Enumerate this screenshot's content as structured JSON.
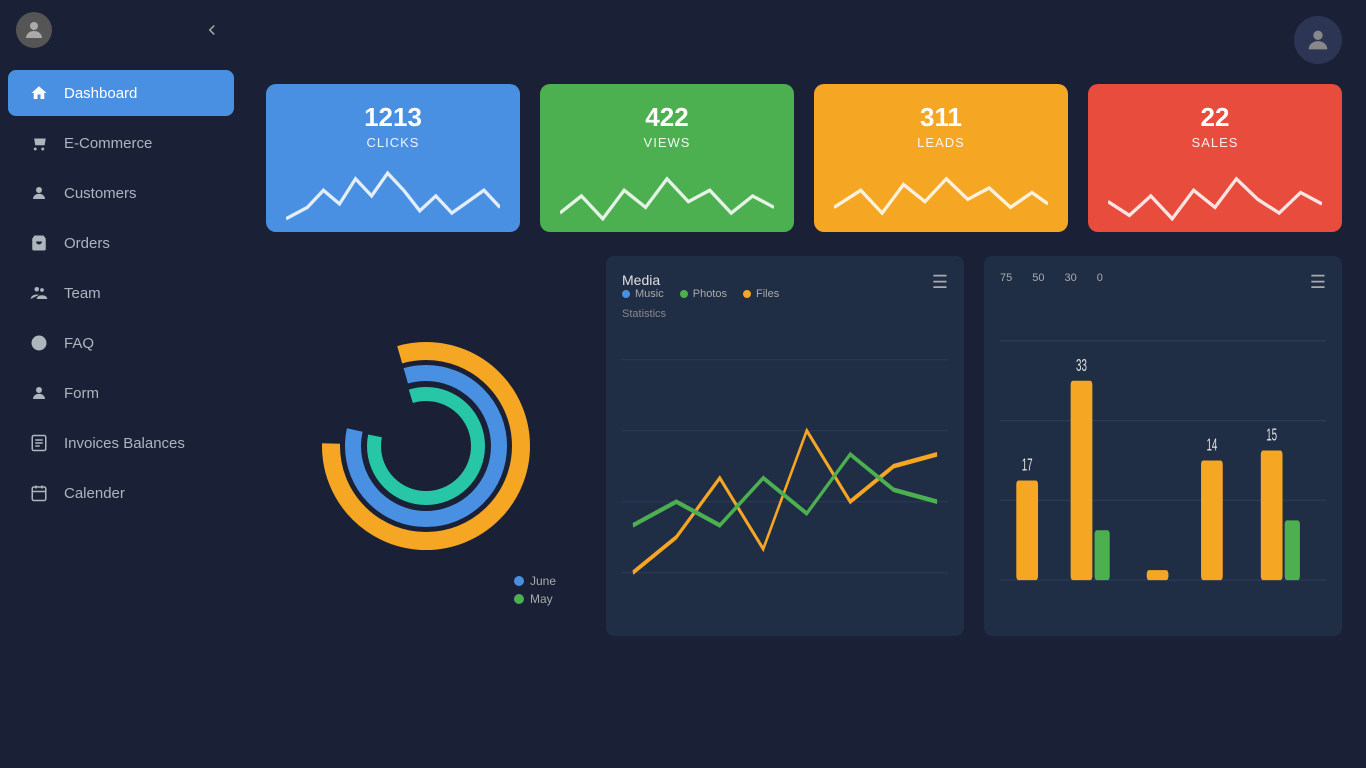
{
  "sidebar": {
    "items": [
      {
        "id": "dashboard",
        "label": "Dashboard",
        "icon": "home",
        "active": true
      },
      {
        "id": "ecommerce",
        "label": "E-Commerce",
        "icon": "cart"
      },
      {
        "id": "customers",
        "label": "Customers",
        "icon": "person"
      },
      {
        "id": "orders",
        "label": "Orders",
        "icon": "bag"
      },
      {
        "id": "team",
        "label": "Team",
        "icon": "group"
      },
      {
        "id": "faq",
        "label": "FAQ",
        "icon": "question"
      },
      {
        "id": "form",
        "label": "Form",
        "icon": "person2"
      },
      {
        "id": "invoices",
        "label": "Invoices Balances",
        "icon": "invoice"
      },
      {
        "id": "calender",
        "label": "Calender",
        "icon": "calendar"
      }
    ]
  },
  "stats": [
    {
      "id": "clicks",
      "number": "1213",
      "label": "CLICKS",
      "color": "blue"
    },
    {
      "id": "views",
      "number": "422",
      "label": "VIEWS",
      "color": "green"
    },
    {
      "id": "leads",
      "number": "311",
      "label": "LEADS",
      "color": "yellow"
    },
    {
      "id": "sales",
      "number": "22",
      "label": "SALES",
      "color": "red"
    }
  ],
  "donut": {
    "legend": [
      {
        "label": "June",
        "color": "#4a90e2"
      },
      {
        "label": "May",
        "color": "#4caf50"
      }
    ]
  },
  "media_chart": {
    "title": "Media",
    "subtitle": "Statistics",
    "legend": [
      {
        "label": "Music",
        "color": "#4a90e2"
      },
      {
        "label": "Photos",
        "color": "#4caf50"
      },
      {
        "label": "Files",
        "color": "#f5a623"
      }
    ]
  },
  "bar_chart": {
    "y_labels": [
      "75",
      "50",
      "30",
      "0"
    ],
    "bars": [
      {
        "val1": 17,
        "val2": 0,
        "color1": "#f5a623",
        "color2": "#4caf50"
      },
      {
        "val1": 33,
        "val2": 4,
        "color1": "#f5a623",
        "color2": "#4caf50"
      },
      {
        "val1": 0,
        "val2": 0
      },
      {
        "val1": 14,
        "val2": 0,
        "color1": "#f5a623"
      },
      {
        "val1": 15,
        "val2": 5,
        "color1": "#f5a623",
        "color2": "#4caf50"
      }
    ]
  }
}
